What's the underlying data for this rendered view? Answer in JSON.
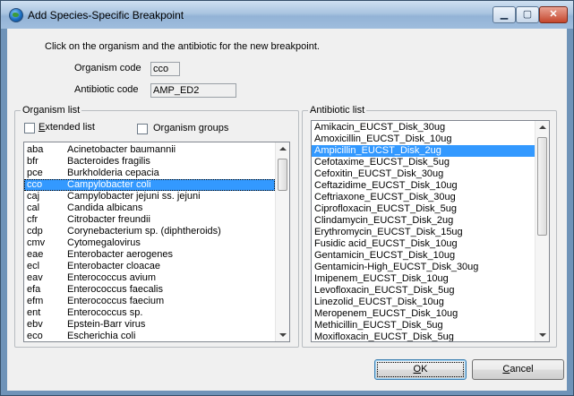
{
  "window": {
    "title": "Add Species-Specific Breakpoint",
    "icon": "globe-icon",
    "controls": {
      "minimize": "▁",
      "maximize": "▢",
      "close": "✕"
    }
  },
  "instructions": "Click on the organism and the antibiotic for the new breakpoint.",
  "fields": {
    "organism_code": {
      "label": "Organism code",
      "value": "cco"
    },
    "antibiotic_code": {
      "label": "Antibiotic code",
      "value": "AMP_ED2"
    }
  },
  "organism_panel": {
    "legend": "Organism list",
    "extended_list": {
      "label": "Extended list",
      "checked": false
    },
    "organism_groups": {
      "label": "Organism groups",
      "checked": false
    },
    "items": [
      {
        "code": "aba",
        "name": "Acinetobacter baumannii"
      },
      {
        "code": "bfr",
        "name": "Bacteroides fragilis"
      },
      {
        "code": "pce",
        "name": "Burkholderia cepacia"
      },
      {
        "code": "cco",
        "name": "Campylobacter coli",
        "selected": true
      },
      {
        "code": "caj",
        "name": "Campylobacter jejuni ss. jejuni"
      },
      {
        "code": "cal",
        "name": "Candida albicans"
      },
      {
        "code": "cfr",
        "name": "Citrobacter freundii"
      },
      {
        "code": "cdp",
        "name": "Corynebacterium sp. (diphtheroids)"
      },
      {
        "code": "cmv",
        "name": "Cytomegalovirus"
      },
      {
        "code": "eae",
        "name": "Enterobacter aerogenes"
      },
      {
        "code": "ecl",
        "name": "Enterobacter cloacae"
      },
      {
        "code": "eav",
        "name": "Enterococcus avium"
      },
      {
        "code": "efa",
        "name": "Enterococcus faecalis"
      },
      {
        "code": "efm",
        "name": "Enterococcus faecium"
      },
      {
        "code": "ent",
        "name": "Enterococcus sp."
      },
      {
        "code": "ebv",
        "name": "Epstein-Barr virus"
      },
      {
        "code": "eco",
        "name": "Escherichia coli"
      }
    ]
  },
  "antibiotic_panel": {
    "legend": "Antibiotic list",
    "items": [
      "Amikacin_EUCST_Disk_30ug",
      "Amoxicillin_EUCST_Disk_10ug",
      "Ampicillin_EUCST_Disk_2ug",
      "Cefotaxime_EUCST_Disk_5ug",
      "Cefoxitin_EUCST_Disk_30ug",
      "Ceftazidime_EUCST_Disk_10ug",
      "Ceftriaxone_EUCST_Disk_30ug",
      "Ciprofloxacin_EUCST_Disk_5ug",
      "Clindamycin_EUCST_Disk_2ug",
      "Erythromycin_EUCST_Disk_15ug",
      "Fusidic acid_EUCST_Disk_10ug",
      "Gentamicin_EUCST_Disk_10ug",
      "Gentamicin-High_EUCST_Disk_30ug",
      "Imipenem_EUCST_Disk_10ug",
      "Levofloxacin_EUCST_Disk_5ug",
      "Linezolid_EUCST_Disk_10ug",
      "Meropenem_EUCST_Disk_10ug",
      "Methicillin_EUCST_Disk_5ug",
      "Moxifloxacin_EUCST_Disk_5ug"
    ],
    "selected_index": 2
  },
  "buttons": {
    "ok": "OK",
    "cancel": "Cancel"
  },
  "colors": {
    "selection": "#3399ff",
    "dialog_face": "#f0f0f0"
  }
}
